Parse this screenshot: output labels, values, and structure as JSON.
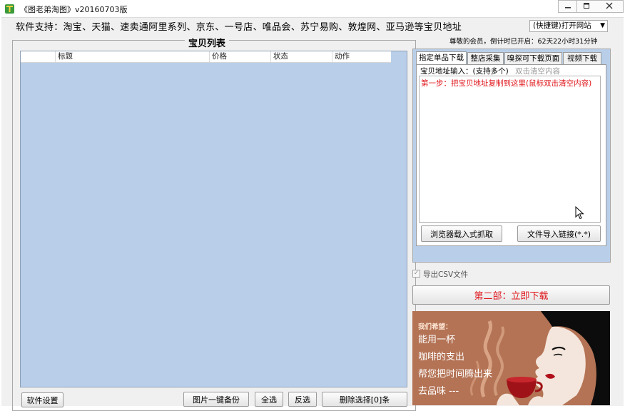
{
  "window": {
    "title": "《图老弟淘图》v20160703版",
    "icon": "app-logo-icon",
    "controls": {
      "minimize": "minimize-icon",
      "maximize": "maximize-icon",
      "close": "close-icon"
    }
  },
  "header": {
    "support_text": "软件支持：淘宝、天猫、速卖通阿里系列、京东、一号店、唯品会、苏宁易购、敦煌网、亚马逊等宝贝地址",
    "quick_select": "(快捷键)打开网站",
    "member_text": "尊敬的会员，倒计时已开启：62天22小时31分钟"
  },
  "list": {
    "title": "宝贝列表",
    "columns": [
      "",
      "标题",
      "价格",
      "状态",
      "动作"
    ],
    "rows": []
  },
  "bottom_buttons": {
    "settings": "软件设置",
    "backup": "图片一键备份",
    "select_all": "全选",
    "invert": "反选",
    "delete": "删除选择[0]条"
  },
  "tabs": [
    "指定单品下载",
    "整店采集",
    "嗅探可下载页面",
    "视频下载"
  ],
  "single_tab": {
    "url_label": "宝贝地址输入：(支持多个)",
    "url_hint": "双击清空内容",
    "step_text": "第一步：把宝贝地址复制到这里(鼠标双击清空内容)",
    "browser_button": "浏览器载入式抓取",
    "file_import_button": "文件导入链接(*.*)"
  },
  "export_csv": {
    "label": "导出CSV文件",
    "checked": true
  },
  "download_button": "第二部：立即下载",
  "ad": {
    "hope": "我们希望：",
    "lines": [
      "能用一杯",
      "咖啡的支出",
      "帮您把时间腾出来",
      "去品味 ---"
    ]
  },
  "colors": {
    "accent_red": "#e0161b",
    "list_bg": "#b9cfe9",
    "ad_bg": "#b47355"
  }
}
